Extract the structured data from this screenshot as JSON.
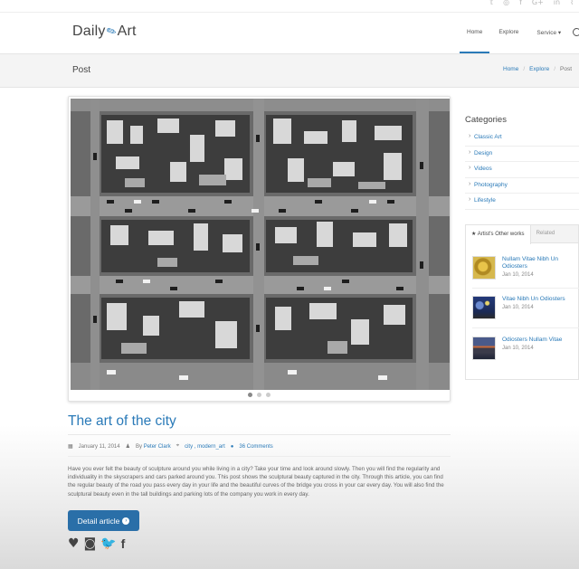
{
  "topbar": {
    "social_icons": [
      "twitter-icon",
      "dribbble-icon",
      "facebook-icon",
      "google-plus-icon",
      "linkedin-icon",
      "rss-icon"
    ]
  },
  "header": {
    "logo_left": "Daily",
    "logo_right": "Art",
    "nav": [
      "Home",
      "Explore",
      "Service ▾"
    ]
  },
  "page": {
    "title": "Post",
    "breadcrumb": [
      "Home",
      "Explore",
      "Post"
    ]
  },
  "article": {
    "title": "The art of the city",
    "date": "January 11, 2014",
    "by": "By",
    "author": "Peter Clark",
    "tags": "city , modern_art",
    "comments": "36 Comments",
    "excerpt": "Have you ever felt the beauty of sculpture around you while living in a city? Take your time and look around slowly. Then you will find the regularity and individuality in the skyscrapers and cars parked around you. This post shows the sculptural beauty captured in the city. Through this article, you can find the regular beauty of the road you pass every day in your life and the beautiful curves of the bridge you cross in your car every day. You will also find the sculptural beauty even in the tall buildings and parking lots of the company you work in every day.",
    "button": "Detail article",
    "carousel_active": 0
  },
  "sidebar": {
    "categories_title": "Categories",
    "categories": [
      "Classic Art",
      "Design",
      "Videos",
      "Photography",
      "Lifestyle"
    ],
    "tabs": [
      "Artist's Other works",
      "Related"
    ],
    "works": [
      {
        "title": "Nullam Vitae Nibh Un Odiosters",
        "date": "Jan 10, 2014"
      },
      {
        "title": "Vitae Nibh Un Odiosters",
        "date": "Jan 10, 2014"
      },
      {
        "title": "Odiosters Nullam Vitae",
        "date": "Jan 10, 2014"
      }
    ]
  },
  "colors": {
    "accent": "#2a7ab8",
    "button": "#2a6fa8"
  }
}
